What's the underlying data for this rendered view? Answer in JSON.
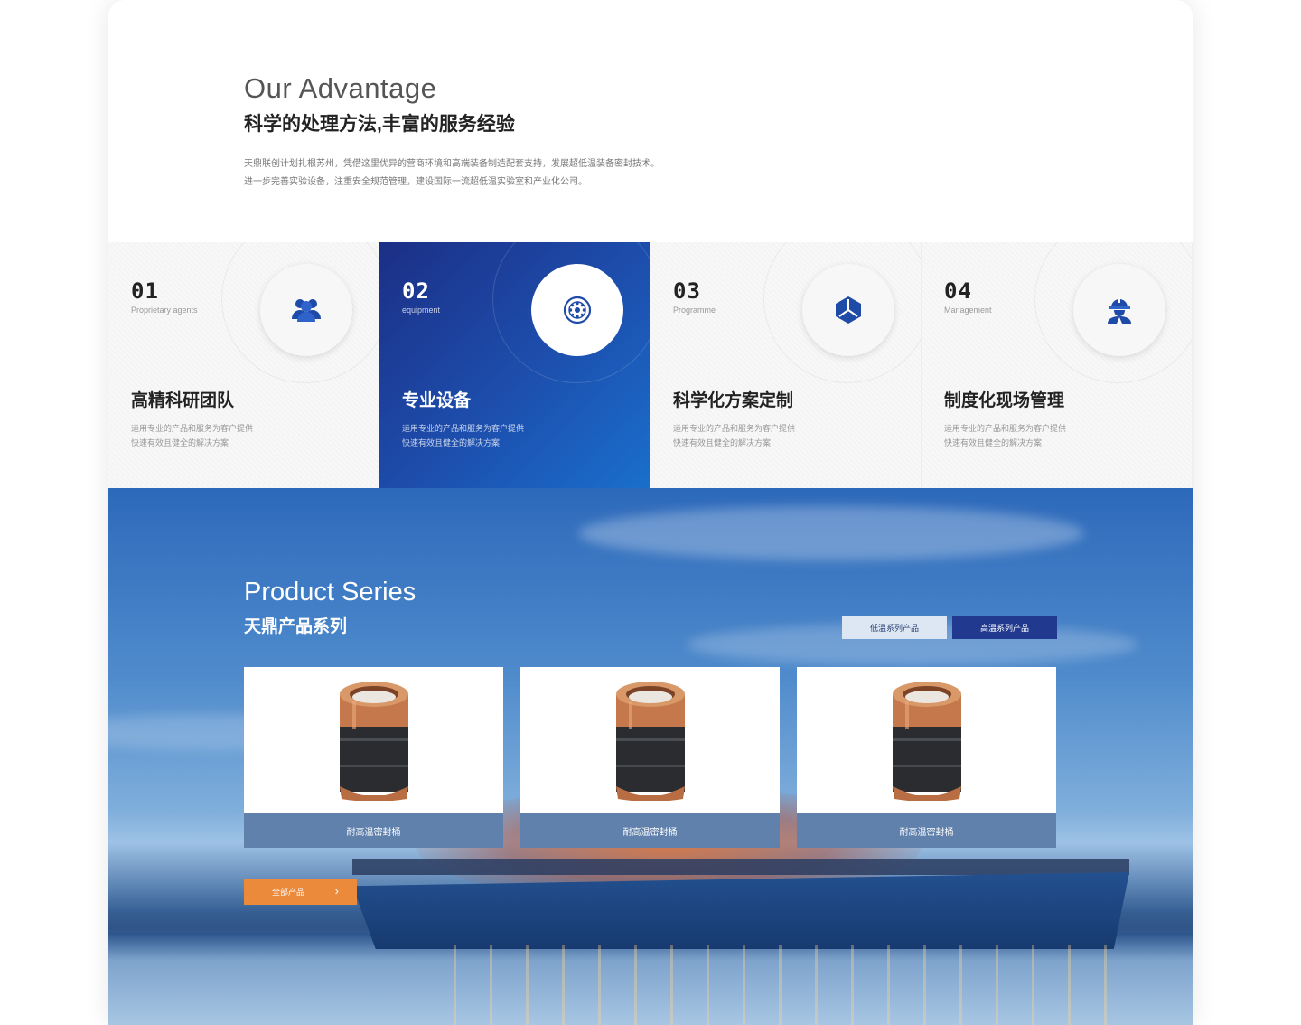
{
  "advantage": {
    "title_en": "Our Advantage",
    "title_cn": "科学的处理方法,丰富的服务经验",
    "desc_line1": "天鼎联创计划扎根苏州，凭借这里优异的营商环境和高端装备制造配套支持，发展超低温装备密封技术。",
    "desc_line2": "进一步完善实验设备，注重安全规范管理，建设国际一流超低温实验室和产业化公司。"
  },
  "features": [
    {
      "num": "01",
      "sub": "Proprietary agents",
      "title": "高精科研团队",
      "desc1": "运用专业的产品和服务为客户提供",
      "desc2": "快速有效且健全的解决方案",
      "icon": "team-icon"
    },
    {
      "num": "02",
      "sub": "equipment",
      "title": "专业设备",
      "desc1": "运用专业的产品和服务为客户提供",
      "desc2": "快速有效且健全的解决方案",
      "icon": "equipment-icon",
      "active": true
    },
    {
      "num": "03",
      "sub": "Programme",
      "title": "科学化方案定制",
      "desc1": "运用专业的产品和服务为客户提供",
      "desc2": "快速有效且健全的解决方案",
      "icon": "cube-icon"
    },
    {
      "num": "04",
      "sub": "Management",
      "title": "制度化现场管理",
      "desc1": "运用专业的产品和服务为客户提供",
      "desc2": "快速有效且健全的解决方案",
      "icon": "worker-icon"
    }
  ],
  "products": {
    "title_en": "Product Series",
    "title_cn": "天鼎产品系列",
    "tabs": [
      {
        "label": "低温系列产品",
        "active": false
      },
      {
        "label": "高温系列产品",
        "active": true
      }
    ],
    "items": [
      {
        "label": "耐高温密封桶"
      },
      {
        "label": "耐高温密封桶"
      },
      {
        "label": "耐高温密封桶"
      }
    ],
    "all_button": "全部产品",
    "all_button_arrow": "›"
  },
  "colors": {
    "accent_blue": "#213a8f",
    "active_gradient_start": "#1c2f86",
    "active_gradient_end": "#1a6fcc",
    "orange_button": "#ec8a3b",
    "icon_blue": "#1e4aa8"
  }
}
